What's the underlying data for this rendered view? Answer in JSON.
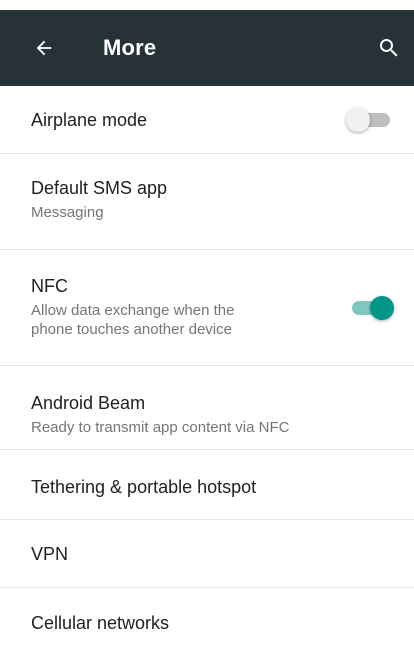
{
  "toolbar": {
    "title": "More",
    "back_icon": "arrow-back-icon",
    "search_icon": "search-icon",
    "background": "#263238"
  },
  "settings": {
    "airplane": {
      "title": "Airplane mode",
      "toggle": "off"
    },
    "sms": {
      "title": "Default SMS app",
      "summary": "Messaging"
    },
    "nfc": {
      "title": "NFC",
      "summary_line1": "Allow data exchange when the",
      "summary_line2": "phone touches another device",
      "toggle": "on"
    },
    "beam": {
      "title": "Android Beam",
      "summary": "Ready to transmit app content via NFC"
    },
    "tethering": {
      "title": "Tethering & portable hotspot"
    },
    "vpn": {
      "title": "VPN"
    },
    "cellular": {
      "title": "Cellular networks"
    }
  },
  "colors": {
    "accent": "#009688",
    "accent_track": "#7fc8c1",
    "primary_text": "#212121",
    "secondary_text": "#757575"
  }
}
